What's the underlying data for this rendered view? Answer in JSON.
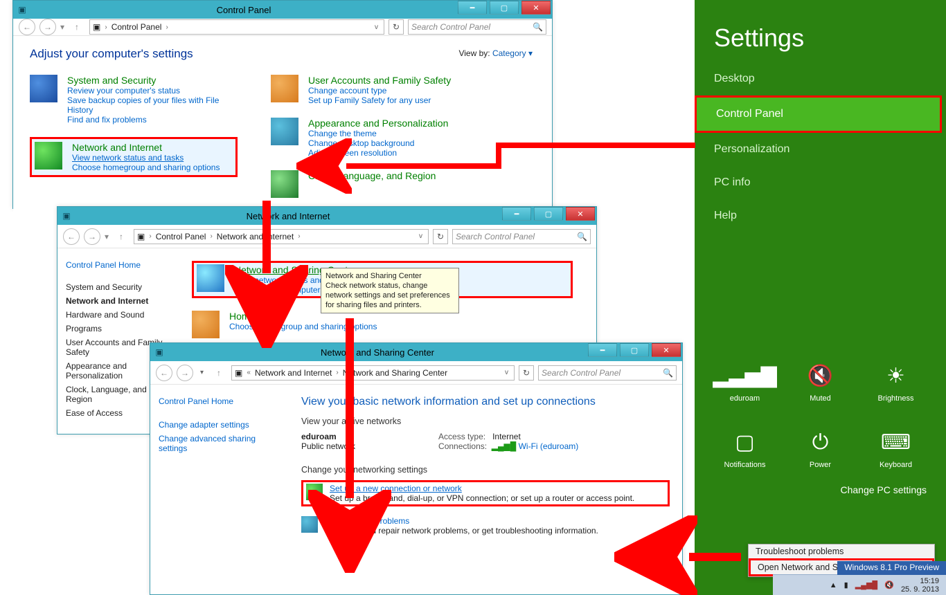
{
  "charm": {
    "title": "Settings",
    "items": [
      "Desktop",
      "Control Panel",
      "Personalization",
      "PC info",
      "Help"
    ],
    "selectedIndex": 1,
    "tiles_a": [
      {
        "glyph": "▂▃▅▇",
        "label": "eduroam"
      },
      {
        "glyph": "🔇",
        "label": "Muted"
      },
      {
        "glyph": "☀",
        "label": "Brightness"
      }
    ],
    "tiles_b": [
      {
        "glyph": "▢",
        "label": "Notifications"
      },
      {
        "glyph": "⏻",
        "label": "Power"
      },
      {
        "glyph": "⌨",
        "label": "Keyboard"
      }
    ],
    "change": "Change PC settings"
  },
  "win1": {
    "title": "Control Panel",
    "breadcrumb": [
      "Control Panel"
    ],
    "search_placeholder": "Search Control Panel",
    "h1": "Adjust your computer's settings",
    "viewby_label": "View by:",
    "viewby_value": "Category ▾",
    "colL": [
      {
        "name": "System and Security",
        "subs": [
          "Review your computer's status",
          "Save backup copies of your files with File History",
          "Find and fix problems"
        ],
        "iconClass": "ic-shield"
      },
      {
        "name": "Network and Internet",
        "subs": [
          "View network status and tasks",
          "Choose homegroup and sharing options"
        ],
        "iconClass": "ic-net",
        "hl": true,
        "underlineFirst": true
      }
    ],
    "colR": [
      {
        "name": "User Accounts and Family Safety",
        "subs": [
          "Change account type",
          "Set up Family Safety for any user"
        ],
        "iconClass": "ic-user",
        "shield": true
      },
      {
        "name": "Appearance and Personalization",
        "subs": [
          "Change the theme",
          "Change desktop background",
          "Adjust screen resolution"
        ],
        "iconClass": "ic-appear"
      },
      {
        "name": "Clock, Language, and Region",
        "subs": [],
        "iconClass": "ic-clock"
      }
    ]
  },
  "win2": {
    "title": "Network and Internet",
    "breadcrumb": [
      "Control Panel",
      "Network and Internet"
    ],
    "search_placeholder": "Search Control Panel",
    "side_home": "Control Panel Home",
    "side_items": [
      "System and Security",
      "Network and Internet",
      "Hardware and Sound",
      "Programs",
      "User Accounts and Family Safety",
      "Appearance and Personalization",
      "Clock, Language, and Region",
      "Ease of Access"
    ],
    "side_bold_index": 1,
    "nsc": {
      "name": "Network and Sharing Center",
      "subs": [
        "View network status and tasks",
        "View network computers and devices"
      ]
    },
    "hg": {
      "name": "HomeGroup",
      "subs": [
        "Choose homegroup and sharing options"
      ]
    },
    "tooltip_title": "Network and Sharing Center",
    "tooltip_body": "Check network status, change network settings and set preferences for sharing files and printers."
  },
  "win3": {
    "title": "Network and Sharing Center",
    "breadcrumb": [
      "Network and Internet",
      "Network and Sharing Center"
    ],
    "search_placeholder": "Search Control Panel",
    "side_home": "Control Panel Home",
    "side_links": [
      "Change adapter settings",
      "Change advanced sharing settings"
    ],
    "h1": "View your basic network information and set up connections",
    "active_label": "View your active networks",
    "conn": {
      "name": "eduroam",
      "type": "Public network",
      "accesstype_label": "Access type:",
      "accesstype_val": "Internet",
      "connections_label": "Connections:",
      "connections_val": "Wi-Fi (eduroam)"
    },
    "change_label": "Change your networking settings",
    "setup": {
      "name": "Set up a new connection or network",
      "sub": "Set up a broadband, dial-up, or VPN connection; or set up a router or access point."
    },
    "trouble": {
      "name": "Troubleshoot problems",
      "sub": "Diagnose and repair network problems, or get troubleshooting information."
    }
  },
  "tray": {
    "items": [
      "Troubleshoot problems",
      "Open Network and Sharing Center"
    ],
    "hl_index": 1,
    "wintext": "Windows 8.1 Pro Preview",
    "time": "15:19",
    "date": "25. 9. 2013"
  }
}
